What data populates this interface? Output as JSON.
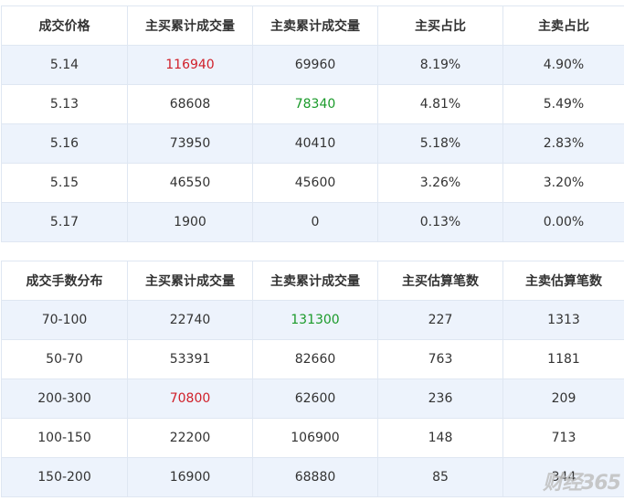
{
  "price_table": {
    "headers": [
      "成交价格",
      "主买累计成交量",
      "主卖累计成交量",
      "主买占比",
      "主卖占比"
    ],
    "rows": [
      [
        "5.14",
        "116940",
        "69960",
        "8.19%",
        "4.90%"
      ],
      [
        "5.13",
        "68608",
        "78340",
        "4.81%",
        "5.49%"
      ],
      [
        "5.16",
        "73950",
        "40410",
        "5.18%",
        "2.83%"
      ],
      [
        "5.15",
        "46550",
        "45600",
        "3.26%",
        "3.20%"
      ],
      [
        "5.17",
        "1900",
        "0",
        "0.13%",
        "0.00%"
      ]
    ]
  },
  "lot_table": {
    "headers": [
      "成交手数分布",
      "主买累计成交量",
      "主卖累计成交量",
      "主买估算笔数",
      "主卖估算笔数"
    ],
    "rows": [
      [
        "70-100",
        "22740",
        "131300",
        "227",
        "1313"
      ],
      [
        "50-70",
        "53391",
        "82660",
        "763",
        "1181"
      ],
      [
        "200-300",
        "70800",
        "62600",
        "236",
        "209"
      ],
      [
        "100-150",
        "22200",
        "106900",
        "148",
        "713"
      ],
      [
        "150-200",
        "16900",
        "68880",
        "85",
        "344"
      ]
    ]
  },
  "highlight_colors": {
    "red": "#d0202a",
    "green": "#1a9a2a"
  },
  "watermark": {
    "text": "财经365"
  }
}
